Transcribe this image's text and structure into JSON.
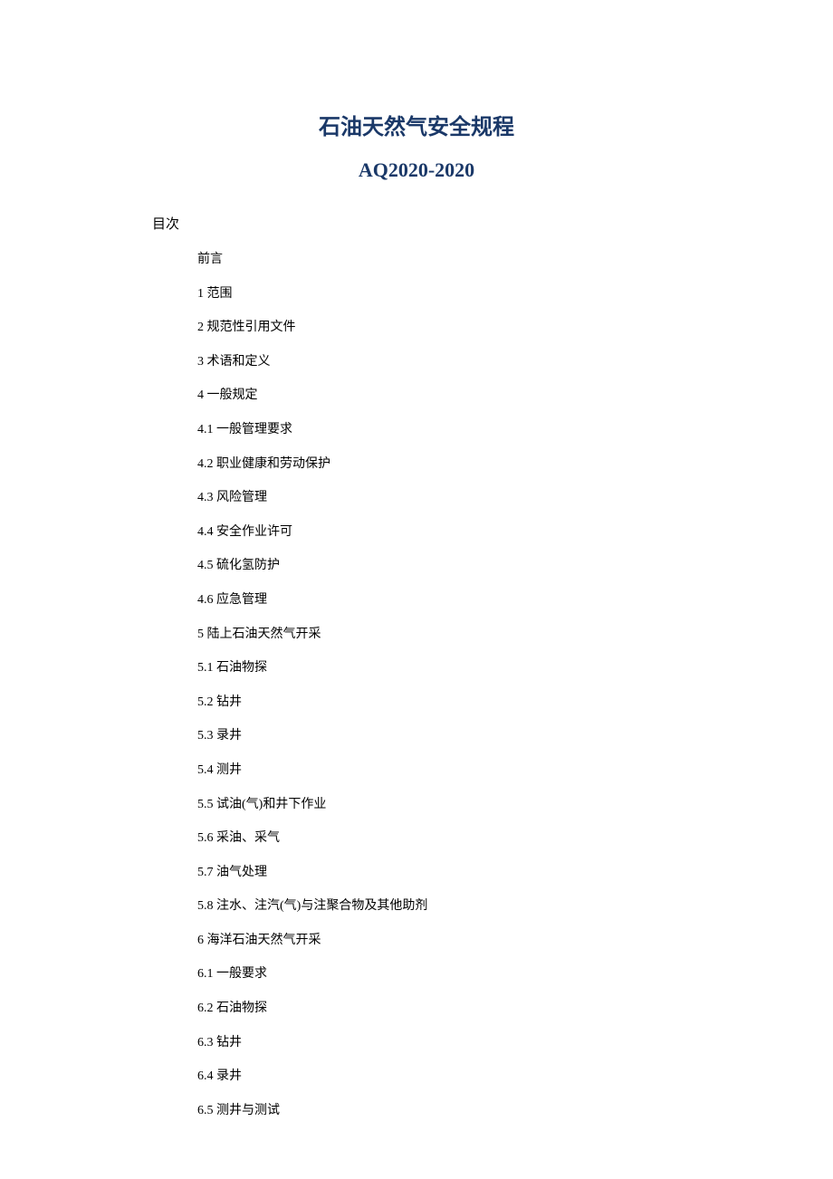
{
  "title": {
    "main": "石油天然气安全规程",
    "sub": "AQ2020-2020"
  },
  "tocLabel": "目次",
  "toc": [
    "前言",
    "1  范围",
    "2  规范性引用文件",
    "3  术语和定义",
    "4  一般规定",
    "4.1  一般管理要求",
    "4.2  职业健康和劳动保护",
    "4.3  风险管理",
    "4.4  安全作业许可",
    "4.5  硫化氢防护",
    "4.6  应急管理",
    "5  陆上石油天然气开采",
    "5.1  石油物探",
    "5.2  钻井",
    "5.3  录井",
    "5.4  测井",
    "5.5  试油(气)和井下作业",
    "5.6  采油、采气",
    "5.7  油气处理",
    "5.8 注水、注汽(气)与注聚合物及其他助剂",
    "6  海洋石油天然气开采",
    "6.1  一般要求",
    "6.2  石油物探",
    "6.3  钻井",
    "6.4  录井",
    "6.5  测井与测试"
  ]
}
